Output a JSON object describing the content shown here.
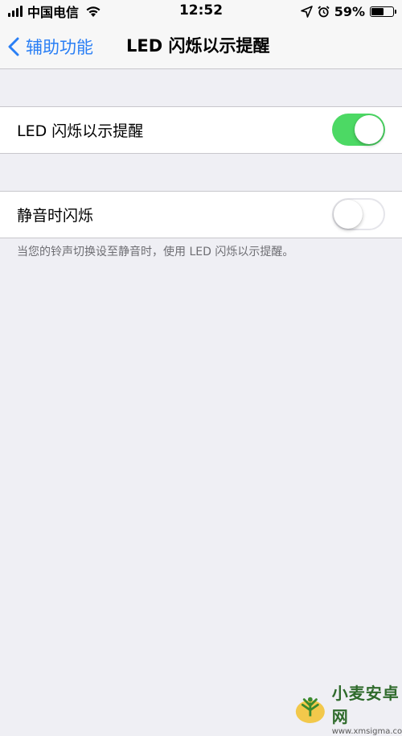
{
  "status_bar": {
    "carrier": "中国电信",
    "time": "12:52",
    "battery_percent": "59%",
    "battery_level": 0.59,
    "icons": [
      "signal-icon",
      "wifi-icon",
      "location-icon",
      "alarm-icon",
      "battery-icon"
    ]
  },
  "nav": {
    "back_label": "辅助功能",
    "title": "LED 闪烁以示提醒"
  },
  "settings": [
    {
      "label": "LED 闪烁以示提醒",
      "toggle": "on"
    },
    {
      "label": "静音时闪烁",
      "toggle": "off"
    }
  ],
  "footer_note": "当您的铃声切换设至静音时，使用 LED 闪烁以示提醒。",
  "colors": {
    "accent": "#2a7ff5",
    "toggle_on": "#4cd964",
    "background": "#efeff4"
  },
  "watermark": {
    "title": "小麦安卓网",
    "url": "www.xmsigma.com"
  }
}
